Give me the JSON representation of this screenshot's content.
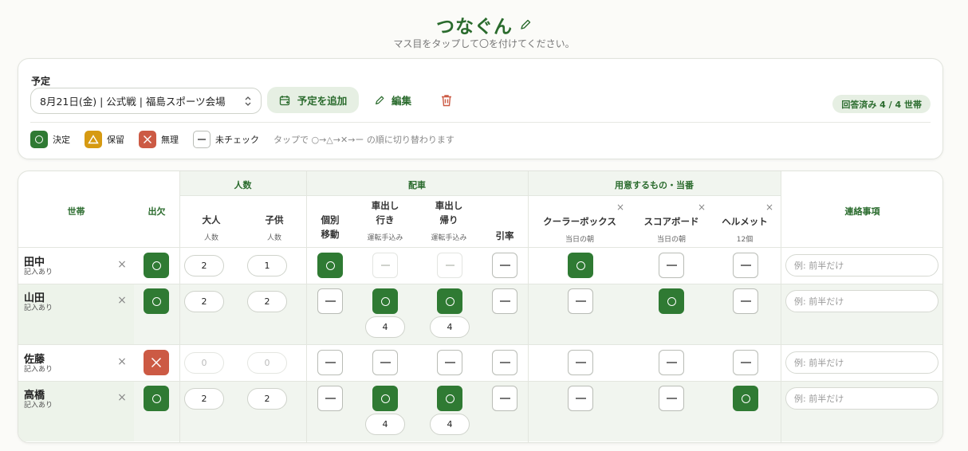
{
  "app": {
    "title": "つなぐん",
    "subtitle": "マス目をタップして〇を付けてください。"
  },
  "schedule": {
    "label": "予定",
    "selected": "8月21日(金) | 公式戦 | 福島スポーツ会場",
    "add_button": "予定を追加",
    "edit_button": "編集",
    "answered": "回答済み 4 / 4 世帯"
  },
  "legend": {
    "items": [
      {
        "key": "ok",
        "label": "決定"
      },
      {
        "key": "hold",
        "label": "保留"
      },
      {
        "key": "ng",
        "label": "無理"
      },
      {
        "key": "none",
        "label": "未チェック"
      }
    ],
    "hint": "タップで ○→△→✕→ー の順に切り替わります"
  },
  "table": {
    "groups": {
      "headcount": "人数",
      "carpool": "配車",
      "supplies": "用意するもの・当番"
    },
    "columns": {
      "household": "世帯",
      "attendance": "出欠",
      "adults": {
        "title": "大人",
        "sub": "人数"
      },
      "kids": {
        "title": "子供",
        "sub": "人数"
      },
      "individual": {
        "line1": "個別",
        "line2": "移動"
      },
      "drive_go": {
        "line1": "車出し",
        "line2": "行き",
        "sub": "運転手込み"
      },
      "drive_back": {
        "line1": "車出し",
        "line2": "帰り",
        "sub": "運転手込み"
      },
      "lead": "引率",
      "cooler": {
        "title": "クーラーボックス",
        "sub": "当日の朝"
      },
      "scoreboard": {
        "title": "スコアボード",
        "sub": "当日の朝"
      },
      "helmet": {
        "title": "ヘルメット",
        "sub": "12個"
      },
      "notes": "連絡事項"
    },
    "rows": [
      {
        "name": "田中",
        "status": "記入あり",
        "attendance": "ok",
        "adults": "2",
        "kids": "1",
        "individual": "ok",
        "drive_go": "disabled",
        "drive_back": "disabled",
        "go_seats": "",
        "back_seats": "",
        "lead": "none",
        "cooler": "ok",
        "scoreboard": "none",
        "helmet": "none",
        "note_placeholder": "例: 前半だけ"
      },
      {
        "name": "山田",
        "status": "記入あり",
        "attendance": "ok",
        "adults": "2",
        "kids": "2",
        "individual": "none",
        "drive_go": "ok",
        "drive_back": "ok",
        "go_seats": "4",
        "back_seats": "4",
        "lead": "none",
        "cooler": "none",
        "scoreboard": "ok",
        "helmet": "none",
        "note_placeholder": "例: 前半だけ"
      },
      {
        "name": "佐藤",
        "status": "記入あり",
        "attendance": "ng",
        "adults": "0",
        "kids": "0",
        "individual": "none",
        "drive_go": "none",
        "drive_back": "none",
        "go_seats": "",
        "back_seats": "",
        "lead": "none",
        "cooler": "none",
        "scoreboard": "none",
        "helmet": "none",
        "note_placeholder": "例: 前半だけ"
      },
      {
        "name": "高橋",
        "status": "記入あり",
        "attendance": "ok",
        "adults": "2",
        "kids": "2",
        "individual": "none",
        "drive_go": "ok",
        "drive_back": "ok",
        "go_seats": "4",
        "back_seats": "4",
        "lead": "none",
        "cooler": "none",
        "scoreboard": "none",
        "helmet": "ok",
        "note_placeholder": "例: 前半だけ"
      }
    ]
  },
  "colors": {
    "accent": "#2a6b2d",
    "ok": "#2f7a33",
    "hold": "#d69a12",
    "ng": "#cc5a44",
    "row_highlight": "#f1f5ef"
  }
}
